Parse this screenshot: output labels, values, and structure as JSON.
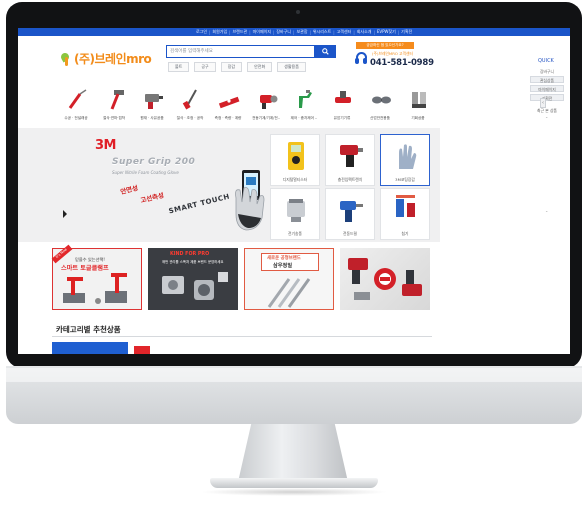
{
  "util_links": [
    "로그인",
    "회원가입",
    "브랜드관",
    "마이페이지",
    "장바구니",
    "보관함",
    "위시리스트",
    "고객센터",
    "회사소개",
    "EVPW찾기",
    "기획전"
  ],
  "logo": {
    "text": "(주)브레인mro"
  },
  "search": {
    "placeholder": "검색어를 입력해주세요",
    "hot_keywords": [
      "볼트",
      "공구",
      "장갑",
      "안전화",
      "생활용품"
    ]
  },
  "cs": {
    "banner": "궁금하신 점 있으신가요?",
    "sub": "(주)브레인MRO 고객센터",
    "phone": "041-581-0989"
  },
  "categories": [
    {
      "label": "수공 · 전설래공",
      "icon": "screwdriver-icon"
    },
    {
      "label": "절삭·연마·접착",
      "icon": "hammer-icon"
    },
    {
      "label": "원재 · 사유공품",
      "icon": "drill-icon"
    },
    {
      "label": "절삭 · 조정 · 공작",
      "icon": "file-tool-icon"
    },
    {
      "label": "측정 · 측량 · 계량",
      "icon": "level-icon"
    },
    {
      "label": "전동기계/기계/전..",
      "icon": "grinder-icon"
    },
    {
      "label": "제어 · 종자제어 ..",
      "icon": "spray-gun-icon"
    },
    {
      "label": "유압기기류",
      "icon": "valve-icon"
    },
    {
      "label": "산업안전용품",
      "icon": "goggles-icon"
    },
    {
      "label": "기회상품",
      "icon": "cutter-icon"
    }
  ],
  "hero": {
    "brand": "3M",
    "title": "Super Grip 200",
    "subtitle": "Super Nitrile Foam Coating Glove",
    "tags": [
      "안면성",
      "고선측성",
      "SMART TOUCH"
    ]
  },
  "tiles": [
    {
      "label": "디지털멀티스터",
      "icon": "multimeter-icon"
    },
    {
      "label": "충전임팩트렌치",
      "icon": "impact-wrench-icon"
    },
    {
      "label": "3M코팅장갑",
      "icon": "glove-icon"
    },
    {
      "label": "전기송풍",
      "icon": "blower-icon"
    },
    {
      "label": "전동드릴",
      "icon": "electric-drill-icon"
    },
    {
      "label": "칩기",
      "icon": "chip-tool-icon"
    }
  ],
  "promos": [
    {
      "ribbon": "It's New",
      "line1": "믿을수 있는선택!",
      "line2": "스마트 토글클램프"
    },
    {
      "line1": "KIND FOR PRO",
      "line2": "매번 관리를 스폭처 제품 브랜드 문영하세요"
    },
    {
      "line1": "새로운 공형브랜드",
      "line2": "삼우정밀"
    },
    {
      "line1": ""
    }
  ],
  "section": {
    "title": "카테고리별 추천상품"
  },
  "quick": {
    "title": "QUICK",
    "items": [
      "장바구니",
      "관심상품",
      "마이페이지",
      "기획전"
    ],
    "recent": "최근 본 상품"
  },
  "colors": {
    "primary": "#1b55c9",
    "accent": "#f28c1a",
    "red": "#e01e26"
  }
}
